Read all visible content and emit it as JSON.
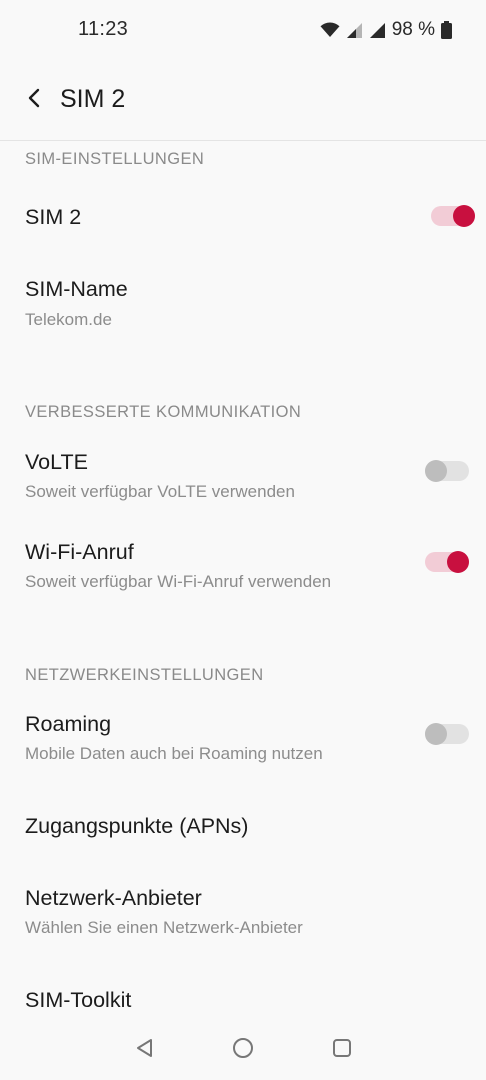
{
  "status_bar": {
    "time": "11:23",
    "battery": "98 %",
    "icons": [
      "wifi-icon",
      "signal-icon",
      "signal-icon",
      "battery-icon"
    ]
  },
  "app_bar": {
    "title": "SIM 2",
    "back_icon": "back-arrow-icon"
  },
  "sections": {
    "sim_settings": "SIM-EINSTELLUNGEN",
    "enhanced_communication": "VERBESSERTE KOMMUNIKATION",
    "network_settings": "NETZWERKEINSTELLUNGEN"
  },
  "items": {
    "sim2": {
      "title": "SIM 2",
      "enabled": true
    },
    "sim_name": {
      "title": "SIM-Name",
      "summary": "Telekom.de"
    },
    "volte": {
      "title": "VoLTE",
      "summary": "Soweit verfügbar VoLTE verwenden",
      "enabled": false
    },
    "wifi_call": {
      "title": "Wi-Fi-Anruf",
      "summary": "Soweit verfügbar Wi-Fi-Anruf verwenden",
      "enabled": true
    },
    "roaming": {
      "title": "Roaming",
      "summary": "Mobile Daten auch bei Roaming nutzen",
      "enabled": false
    },
    "apn": {
      "title": "Zugangspunkte (APNs)"
    },
    "network_provider": {
      "title": "Netzwerk-Anbieter",
      "summary": "Wählen Sie einen Netzwerk-Anbieter"
    },
    "sim_toolkit": {
      "title": "SIM-Toolkit"
    }
  },
  "colors": {
    "accent": "#c8103f",
    "accent_track": "#f2ccd6",
    "background": "#f9f9f9",
    "secondary_text": "#8c8c8c"
  },
  "nav_bar": {
    "icons": [
      "back-triangle-icon",
      "home-circle-icon",
      "recents-square-icon"
    ]
  }
}
